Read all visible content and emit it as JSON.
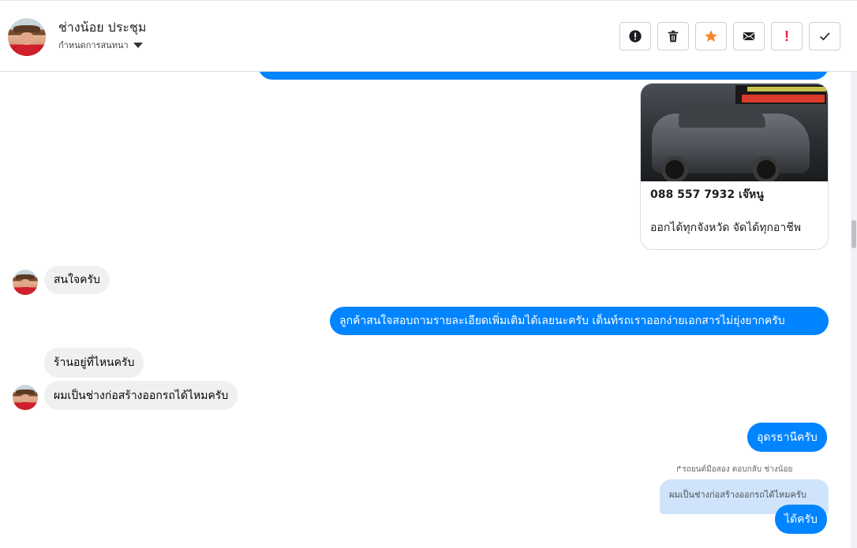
{
  "header": {
    "contact_name": "ช่างน้อย ประชุม",
    "subtitle": "กำหนดการสนทนา",
    "actions": [
      {
        "name": "report-button",
        "icon": "alert-circle-icon"
      },
      {
        "name": "delete-button",
        "icon": "trash-icon"
      },
      {
        "name": "star-button",
        "icon": "star-icon"
      },
      {
        "name": "mark-unread-button",
        "icon": "envelope-icon"
      },
      {
        "name": "important-button",
        "icon": "exclamation-icon",
        "label": "!"
      },
      {
        "name": "done-button",
        "icon": "check-icon"
      }
    ]
  },
  "card": {
    "phone": "088 557 7932 เจ๊หนู",
    "description": "ออกได้ทุกจังหวัด จัดได้ทุกอาชีพ"
  },
  "messages": {
    "m1": "สนใจครับ",
    "m2": "ลูกค้าสนใจสอบถามรายละเอียดเพิ่มเติมได้เลยนะครับ เต็นท์รถเราออกง่ายเอกสารไม่ยุ่งยากครับ",
    "m3": "ร้านอยู่ที่ไหนครับ",
    "m4": "ผมเป็นช่างก่อสร้างออกรถได้ไหมครับ",
    "m5": "อุดรธานีครับ",
    "reply_meta": "รถยนต์มือสอง ตอบกลับ ช่างน้อย",
    "reply_quote": "ผมเป็นช่างก่อสร้างออกรถได้ไหมครับ",
    "m6": "ได้ครับ"
  },
  "colors": {
    "outgoing": "#0084ff",
    "incoming": "#f0f0f0",
    "star": "#f5862b",
    "important": "#e41e3f"
  }
}
